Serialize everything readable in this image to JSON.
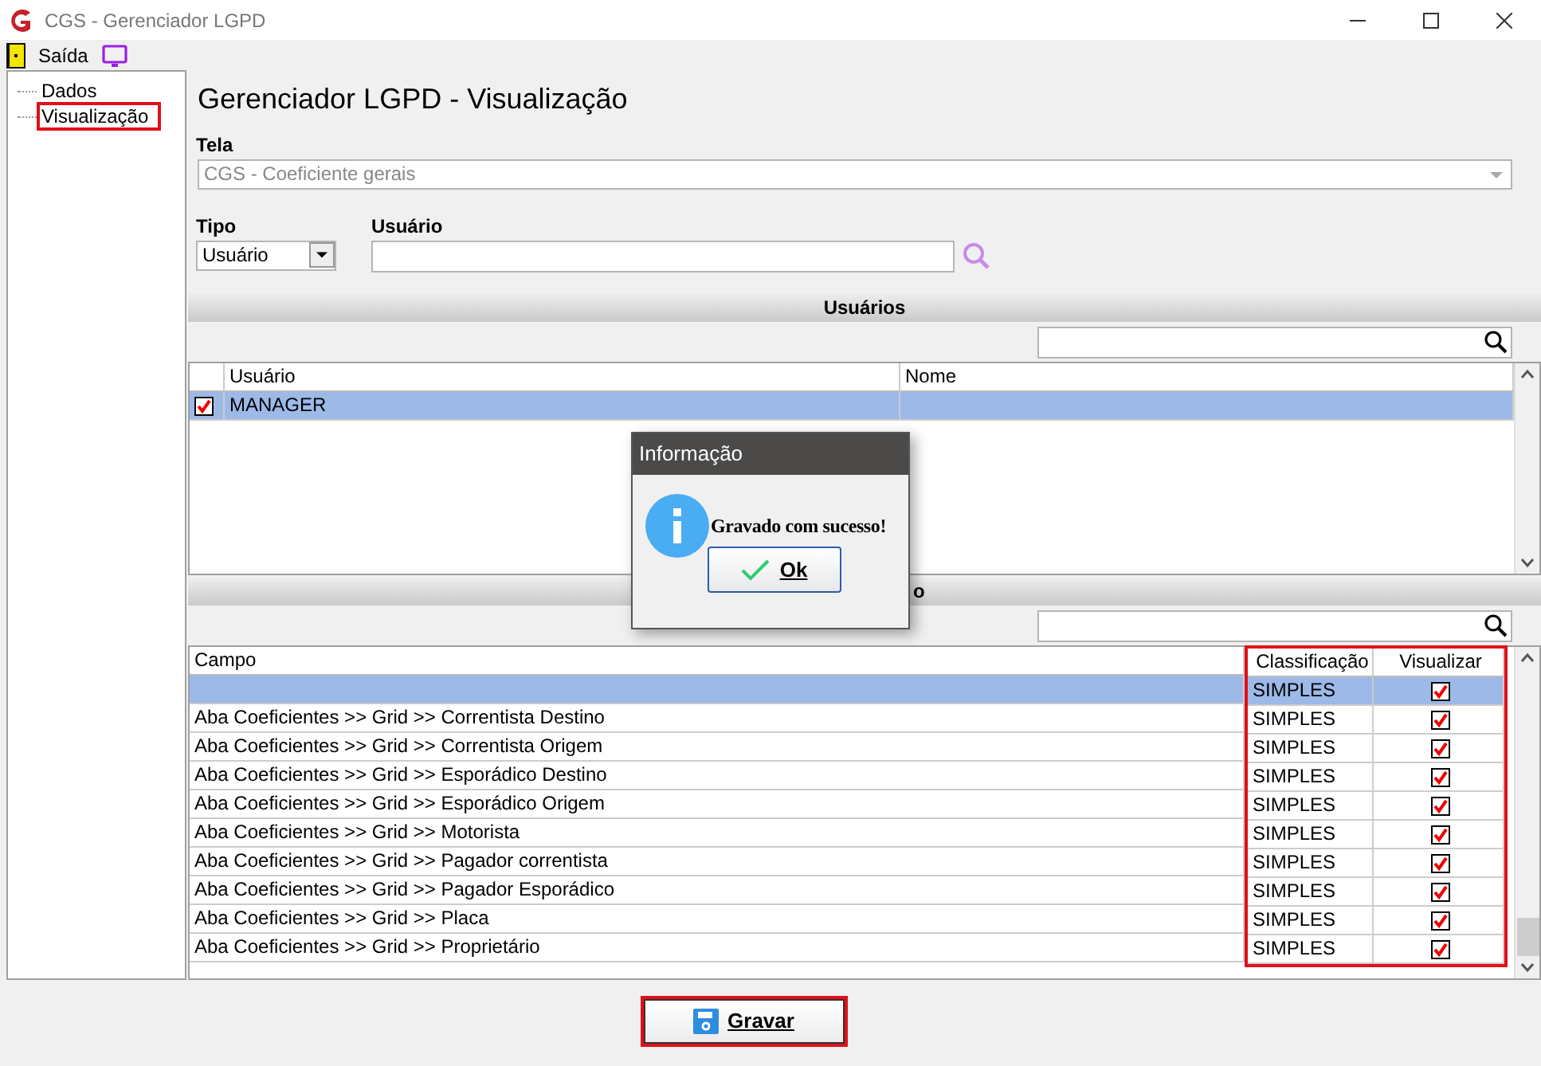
{
  "window": {
    "title": "CGS - Gerenciador LGPD"
  },
  "menu": [
    {
      "label": "Saída"
    }
  ],
  "tree": [
    {
      "label": "Dados",
      "highlighted": false
    },
    {
      "label": "Visualização",
      "highlighted": true
    }
  ],
  "heading": "Gerenciador LGPD - Visualização",
  "tela": {
    "label": "Tela",
    "value": "CGS - Coeficiente gerais",
    "disabled": true
  },
  "tipo": {
    "label": "Tipo",
    "value": "Usuário"
  },
  "usuario": {
    "label": "Usuário"
  },
  "users_section": {
    "title": "Usuários",
    "columns": [
      "Usuário",
      "Nome"
    ],
    "rows": [
      {
        "checked": true,
        "selected": true,
        "usuario": "MANAGER"
      }
    ]
  },
  "fields_section": {
    "title": "o",
    "columns": [
      {
        "label": "Campo",
        "highlighted": false
      },
      {
        "label": "Classificação",
        "highlighted": true
      },
      {
        "label": "Visualizar",
        "highlighted": true
      }
    ],
    "rows": [
      {
        "selected": true,
        "classificacao": "SIMPLES",
        "visualizar": true
      },
      {
        "selected": false,
        "campo": "Aba Coeficientes >> Grid >> Correntista Destino",
        "classificacao": "SIMPLES",
        "visualizar": true
      },
      {
        "selected": false,
        "campo": "Aba Coeficientes >> Grid >> Correntista Origem",
        "classificacao": "SIMPLES",
        "visualizar": true
      },
      {
        "selected": false,
        "campo": "Aba Coeficientes >> Grid >> Esporádico Destino",
        "classificacao": "SIMPLES",
        "visualizar": true
      },
      {
        "selected": false,
        "campo": "Aba Coeficientes >> Grid >> Esporádico Origem",
        "classificacao": "SIMPLES",
        "visualizar": true
      },
      {
        "selected": false,
        "campo": "Aba Coeficientes >> Grid >> Motorista",
        "classificacao": "SIMPLES",
        "visualizar": true
      },
      {
        "selected": false,
        "campo": "Aba Coeficientes >> Grid >> Pagador correntista",
        "classificacao": "SIMPLES",
        "visualizar": true
      },
      {
        "selected": false,
        "campo": "Aba Coeficientes >> Grid >> Pagador Esporádico",
        "classificacao": "SIMPLES",
        "visualizar": true
      },
      {
        "selected": false,
        "campo": "Aba Coeficientes >> Grid >> Placa",
        "classificacao": "SIMPLES",
        "visualizar": true
      },
      {
        "selected": false,
        "campo": "Aba Coeficientes >> Grid >> Proprietário",
        "classificacao": "SIMPLES",
        "visualizar": true
      }
    ]
  },
  "save_button": {
    "label": "Gravar",
    "highlighted": true
  },
  "dialog": {
    "title": "Informação",
    "message": "Gravado com sucesso!",
    "button": "Ok"
  }
}
